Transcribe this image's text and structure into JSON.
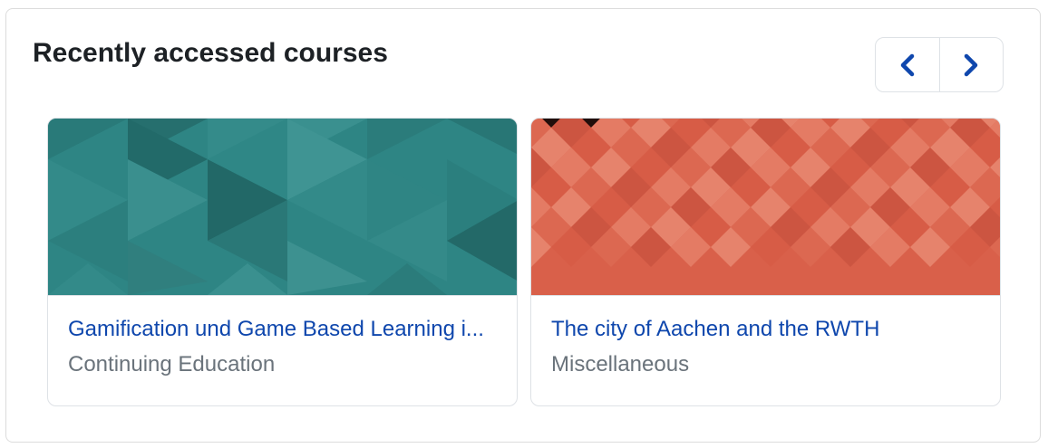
{
  "block": {
    "title": "Recently accessed courses",
    "prev_icon": "chevron-left-icon",
    "next_icon": "chevron-right-icon",
    "accent_color": "#0f47ad"
  },
  "courses": [
    {
      "name": "Gamification und Game Based Learning i...",
      "category": "Continuing Education",
      "image_color": "#2e8584"
    },
    {
      "name": "The city of Aachen and the RWTH",
      "category": "Miscellaneous",
      "image_color": "#d9604a"
    }
  ]
}
